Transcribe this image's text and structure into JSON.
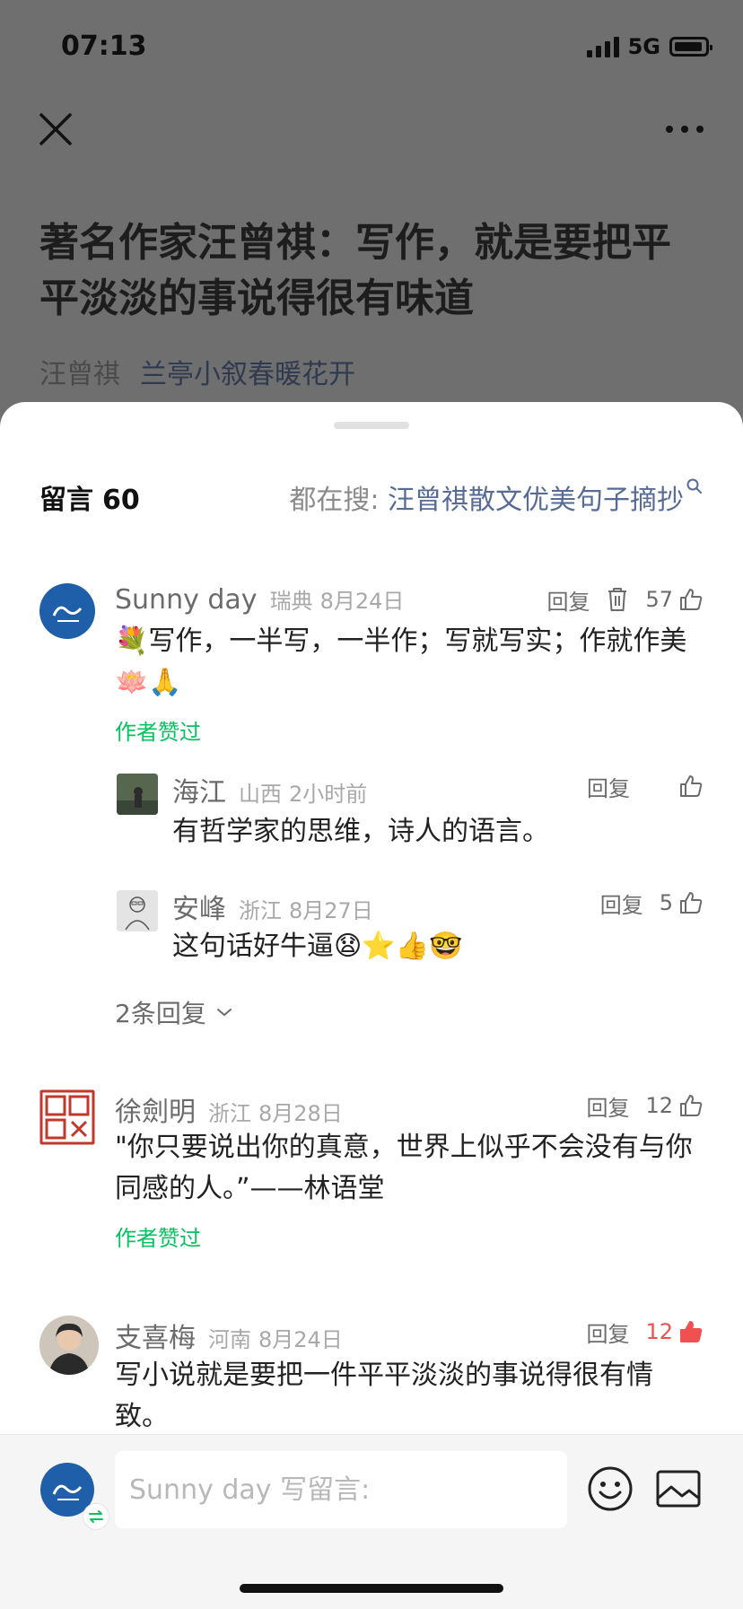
{
  "status_bar": {
    "time": "07:13",
    "network": "5G"
  },
  "article": {
    "title": "著名作家汪曾祺：写作，就是要把平平淡淡的事说得很有味道",
    "author": "汪曾祺",
    "account": "兰亭小叙春暖花开"
  },
  "comments_header": {
    "title": "留言",
    "count": "60",
    "search_prefix": "都在搜:",
    "search_term": "汪曾祺散文优美句子摘抄"
  },
  "comments": [
    {
      "name": "Sunny  day",
      "location": "瑞典",
      "date": "8月24日",
      "reply_label": "回复",
      "likes": "57",
      "text": "💐写作，一半写，一半作；写就写实；作就作美🪷🙏",
      "author_liked": "作者赞过",
      "replies": [
        {
          "name": "海江",
          "location": "山西",
          "date": "2小时前",
          "reply_label": "回复",
          "likes": "",
          "text": "有哲学家的思维，诗人的语言。"
        },
        {
          "name": "安峰",
          "location": "浙江",
          "date": "8月27日",
          "reply_label": "回复",
          "likes": "5",
          "text": "这句话好牛逼😧⭐👍🤓"
        }
      ],
      "more_replies": "2条回复"
    },
    {
      "name": "徐劍明",
      "location": "浙江",
      "date": "8月28日",
      "reply_label": "回复",
      "likes": "12",
      "text": "\"你只要说出你的真意，世界上似乎不会没有与你同感的人。”——林语堂",
      "author_liked": "作者赞过"
    },
    {
      "name": "支喜梅",
      "location": "河南",
      "date": "8月24日",
      "reply_label": "回复",
      "likes": "12",
      "text": "写小说就是要把一件平平淡淡的事说得很有情致。"
    }
  ],
  "input_bar": {
    "placeholder": "Sunny day 写留言:"
  },
  "colors": {
    "link": "#576b95",
    "author_liked": "#07c160",
    "liked_red": "#f05050"
  }
}
